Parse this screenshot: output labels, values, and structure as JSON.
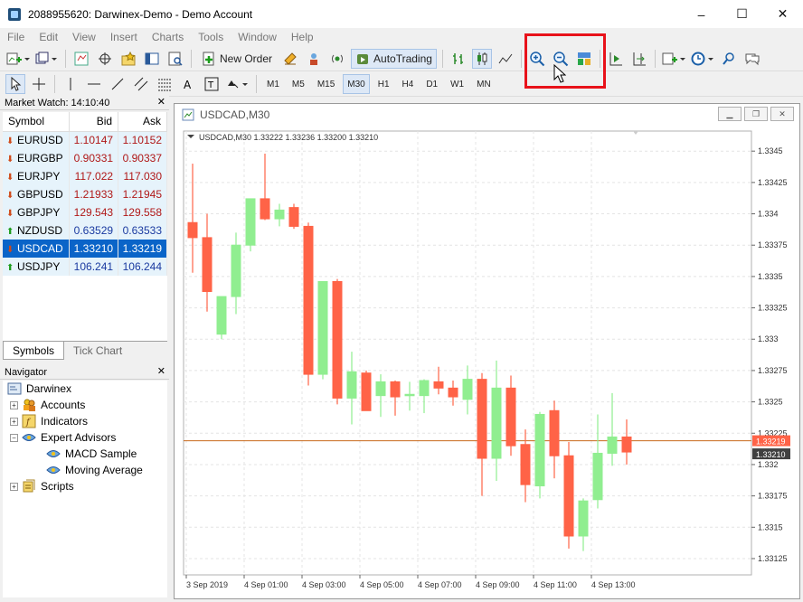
{
  "window": {
    "title": "2088955620: Darwinex-Demo - Demo Account",
    "min": "–",
    "max": "☐",
    "close": "✕"
  },
  "menu": [
    "File",
    "Edit",
    "View",
    "Insert",
    "Charts",
    "Tools",
    "Window",
    "Help"
  ],
  "toolbar": {
    "new_order": "New Order",
    "autotrading": "AutoTrading"
  },
  "timeframes": [
    "M1",
    "M5",
    "M15",
    "M30",
    "H1",
    "H4",
    "D1",
    "W1",
    "MN"
  ],
  "selected_timeframe": "M30",
  "market_watch": {
    "title": "Market Watch: 14:10:40",
    "headers": {
      "symbol": "Symbol",
      "bid": "Bid",
      "ask": "Ask"
    },
    "rows": [
      {
        "symbol": "EURUSD",
        "bid": "1.10147",
        "ask": "1.10152",
        "dir": "down"
      },
      {
        "symbol": "EURGBP",
        "bid": "0.90331",
        "ask": "0.90337",
        "dir": "down"
      },
      {
        "symbol": "EURJPY",
        "bid": "117.022",
        "ask": "117.030",
        "dir": "down"
      },
      {
        "symbol": "GBPUSD",
        "bid": "1.21933",
        "ask": "1.21945",
        "dir": "down"
      },
      {
        "symbol": "GBPJPY",
        "bid": "129.543",
        "ask": "129.558",
        "dir": "down"
      },
      {
        "symbol": "NZDUSD",
        "bid": "0.63529",
        "ask": "0.63533",
        "dir": "up"
      },
      {
        "symbol": "USDCAD",
        "bid": "1.33210",
        "ask": "1.33219",
        "dir": "down",
        "selected": true
      },
      {
        "symbol": "USDJPY",
        "bid": "106.241",
        "ask": "106.244",
        "dir": "up"
      }
    ],
    "tabs": [
      "Symbols",
      "Tick Chart"
    ]
  },
  "navigator": {
    "title": "Navigator",
    "items": [
      "Darwinex",
      "Accounts",
      "Indicators",
      "Expert Advisors",
      "MACD Sample",
      "Moving Average",
      "Scripts"
    ]
  },
  "chart": {
    "window_title": "USDCAD,M30",
    "info_line": "USDCAD,M30  1.33222 1.33236 1.33200 1.33210",
    "bid_label": "1.33210",
    "ask_label": "1.33219",
    "colors": {
      "bull": "#90ee90",
      "bear": "#ff6347",
      "ask_line": "#c8691c",
      "bid_tag": "#404040",
      "ask_tag": "#ff6347"
    }
  },
  "chart_data": {
    "type": "candlestick",
    "symbol": "USDCAD",
    "timeframe": "M30",
    "ylim": [
      1.33112,
      1.33466
    ],
    "y_ticks": [
      1.3345,
      1.33425,
      1.334,
      1.33375,
      1.3335,
      1.33325,
      1.333,
      1.33275,
      1.3325,
      1.33225,
      1.332,
      1.33175,
      1.3315,
      1.33125
    ],
    "x_ticks": [
      {
        "index": 0,
        "label": "3 Sep 2019"
      },
      {
        "index": 4,
        "label": "4 Sep 01:00"
      },
      {
        "index": 8,
        "label": "4 Sep 03:00"
      },
      {
        "index": 12,
        "label": "4 Sep 05:00"
      },
      {
        "index": 16,
        "label": "4 Sep 07:00"
      },
      {
        "index": 20,
        "label": "4 Sep 09:00"
      },
      {
        "index": 24,
        "label": "4 Sep 11:00"
      },
      {
        "index": 28,
        "label": "4 Sep 13:00"
      }
    ],
    "candles": [
      {
        "o": 1.33393,
        "h": 1.3344,
        "l": 1.33353,
        "c": 1.33381
      },
      {
        "o": 1.33381,
        "h": 1.334,
        "l": 1.33322,
        "c": 1.33338
      },
      {
        "o": 1.33304,
        "h": 1.33334,
        "l": 1.333,
        "c": 1.33334
      },
      {
        "o": 1.33334,
        "h": 1.33385,
        "l": 1.3332,
        "c": 1.33375
      },
      {
        "o": 1.33375,
        "h": 1.33411,
        "l": 1.3337,
        "c": 1.33412
      },
      {
        "o": 1.33412,
        "h": 1.33448,
        "l": 1.33395,
        "c": 1.33396
      },
      {
        "o": 1.33396,
        "h": 1.33408,
        "l": 1.3339,
        "c": 1.33403
      },
      {
        "o": 1.33405,
        "h": 1.33408,
        "l": 1.33388,
        "c": 1.3339
      },
      {
        "o": 1.3339,
        "h": 1.33393,
        "l": 1.33263,
        "c": 1.33272
      },
      {
        "o": 1.33272,
        "h": 1.33312,
        "l": 1.33268,
        "c": 1.33346
      },
      {
        "o": 1.33346,
        "h": 1.33348,
        "l": 1.33248,
        "c": 1.33253
      },
      {
        "o": 1.33253,
        "h": 1.3329,
        "l": 1.33232,
        "c": 1.33274
      },
      {
        "o": 1.33273,
        "h": 1.33275,
        "l": 1.3325,
        "c": 1.33243
      },
      {
        "o": 1.33255,
        "h": 1.33272,
        "l": 1.33238,
        "c": 1.33266
      },
      {
        "o": 1.33266,
        "h": 1.33267,
        "l": 1.33239,
        "c": 1.33254
      },
      {
        "o": 1.33256,
        "h": 1.33266,
        "l": 1.33243,
        "c": 1.33256
      },
      {
        "o": 1.33255,
        "h": 1.33268,
        "l": 1.33241,
        "c": 1.33267
      },
      {
        "o": 1.33266,
        "h": 1.33278,
        "l": 1.33256,
        "c": 1.33261
      },
      {
        "o": 1.33261,
        "h": 1.33267,
        "l": 1.33247,
        "c": 1.33254
      },
      {
        "o": 1.33252,
        "h": 1.33279,
        "l": 1.3324,
        "c": 1.33268
      },
      {
        "o": 1.33268,
        "h": 1.33273,
        "l": 1.33175,
        "c": 1.33205
      },
      {
        "o": 1.33205,
        "h": 1.33283,
        "l": 1.33187,
        "c": 1.33261
      },
      {
        "o": 1.33261,
        "h": 1.33271,
        "l": 1.33207,
        "c": 1.33215
      },
      {
        "o": 1.33216,
        "h": 1.33228,
        "l": 1.3317,
        "c": 1.33184
      },
      {
        "o": 1.33183,
        "h": 1.33242,
        "l": 1.33173,
        "c": 1.3324
      },
      {
        "o": 1.33243,
        "h": 1.33251,
        "l": 1.33189,
        "c": 1.33207
      },
      {
        "o": 1.33207,
        "h": 1.33218,
        "l": 1.33133,
        "c": 1.33143
      },
      {
        "o": 1.33143,
        "h": 1.33173,
        "l": 1.33131,
        "c": 1.33171
      },
      {
        "o": 1.33172,
        "h": 1.3324,
        "l": 1.33165,
        "c": 1.33209
      },
      {
        "o": 1.33209,
        "h": 1.33257,
        "l": 1.33199,
        "c": 1.33222
      },
      {
        "o": 1.33222,
        "h": 1.33236,
        "l": 1.332,
        "c": 1.3321
      }
    ],
    "ask_price": 1.33219,
    "bid_price": 1.3321
  }
}
